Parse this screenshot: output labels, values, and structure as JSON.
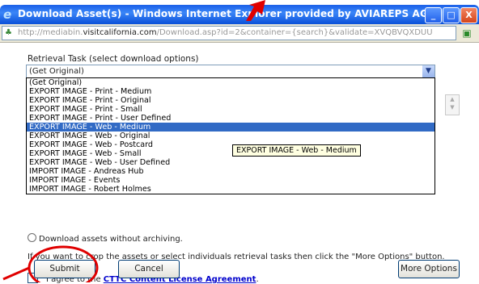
{
  "window": {
    "title": "Download Asset(s) - Windows Internet Explorer provided by AVIAREPS AG",
    "min_glyph": "_",
    "max_glyph": "□",
    "close_glyph": "X"
  },
  "address_bar": {
    "url_prefix": "http://mediabin.",
    "url_host": "visitcalifornia.com",
    "url_rest": "/Download.asp?id=2&container={search}&validate=XVQBVQXDUU"
  },
  "form": {
    "retrieval_label": "Retrieval Task (select download options)",
    "selected_value": "(Get Original)",
    "options": [
      "(Get Original)",
      "EXPORT IMAGE - Print - Medium",
      "EXPORT IMAGE - Print - Original",
      "EXPORT IMAGE - Print - Small",
      "EXPORT IMAGE - Print - User Defined",
      "EXPORT IMAGE - Web - Medium",
      "EXPORT IMAGE - Web - Original",
      "EXPORT IMAGE - Web - Postcard",
      "EXPORT IMAGE - Web - Small",
      "EXPORT IMAGE - Web - User Defined",
      "IMPORT IMAGE - Andreas Hub",
      "IMPORT IMAGE - Events",
      "IMPORT IMAGE - Robert Holmes"
    ],
    "highlighted_option": "EXPORT IMAGE - Web - Medium",
    "tooltip": "EXPORT IMAGE - Web - Medium",
    "partial_radio_text": "Download assets without archiving.",
    "crop_text": "If you want to crop the assets or select individuals retrieval tasks then click the \"More Options\" button.",
    "agree_prefix": "I agree to the",
    "agree_link": "CTTC Content License Agreement",
    "agree_suffix": "."
  },
  "buttons": {
    "submit": "Submit",
    "cancel": "Cancel",
    "more_options": "More Options"
  },
  "colors": {
    "titlebar": "#1a5fe8",
    "selection": "#316ac5",
    "annotation_red": "#e00000",
    "link": "#0000cc"
  }
}
